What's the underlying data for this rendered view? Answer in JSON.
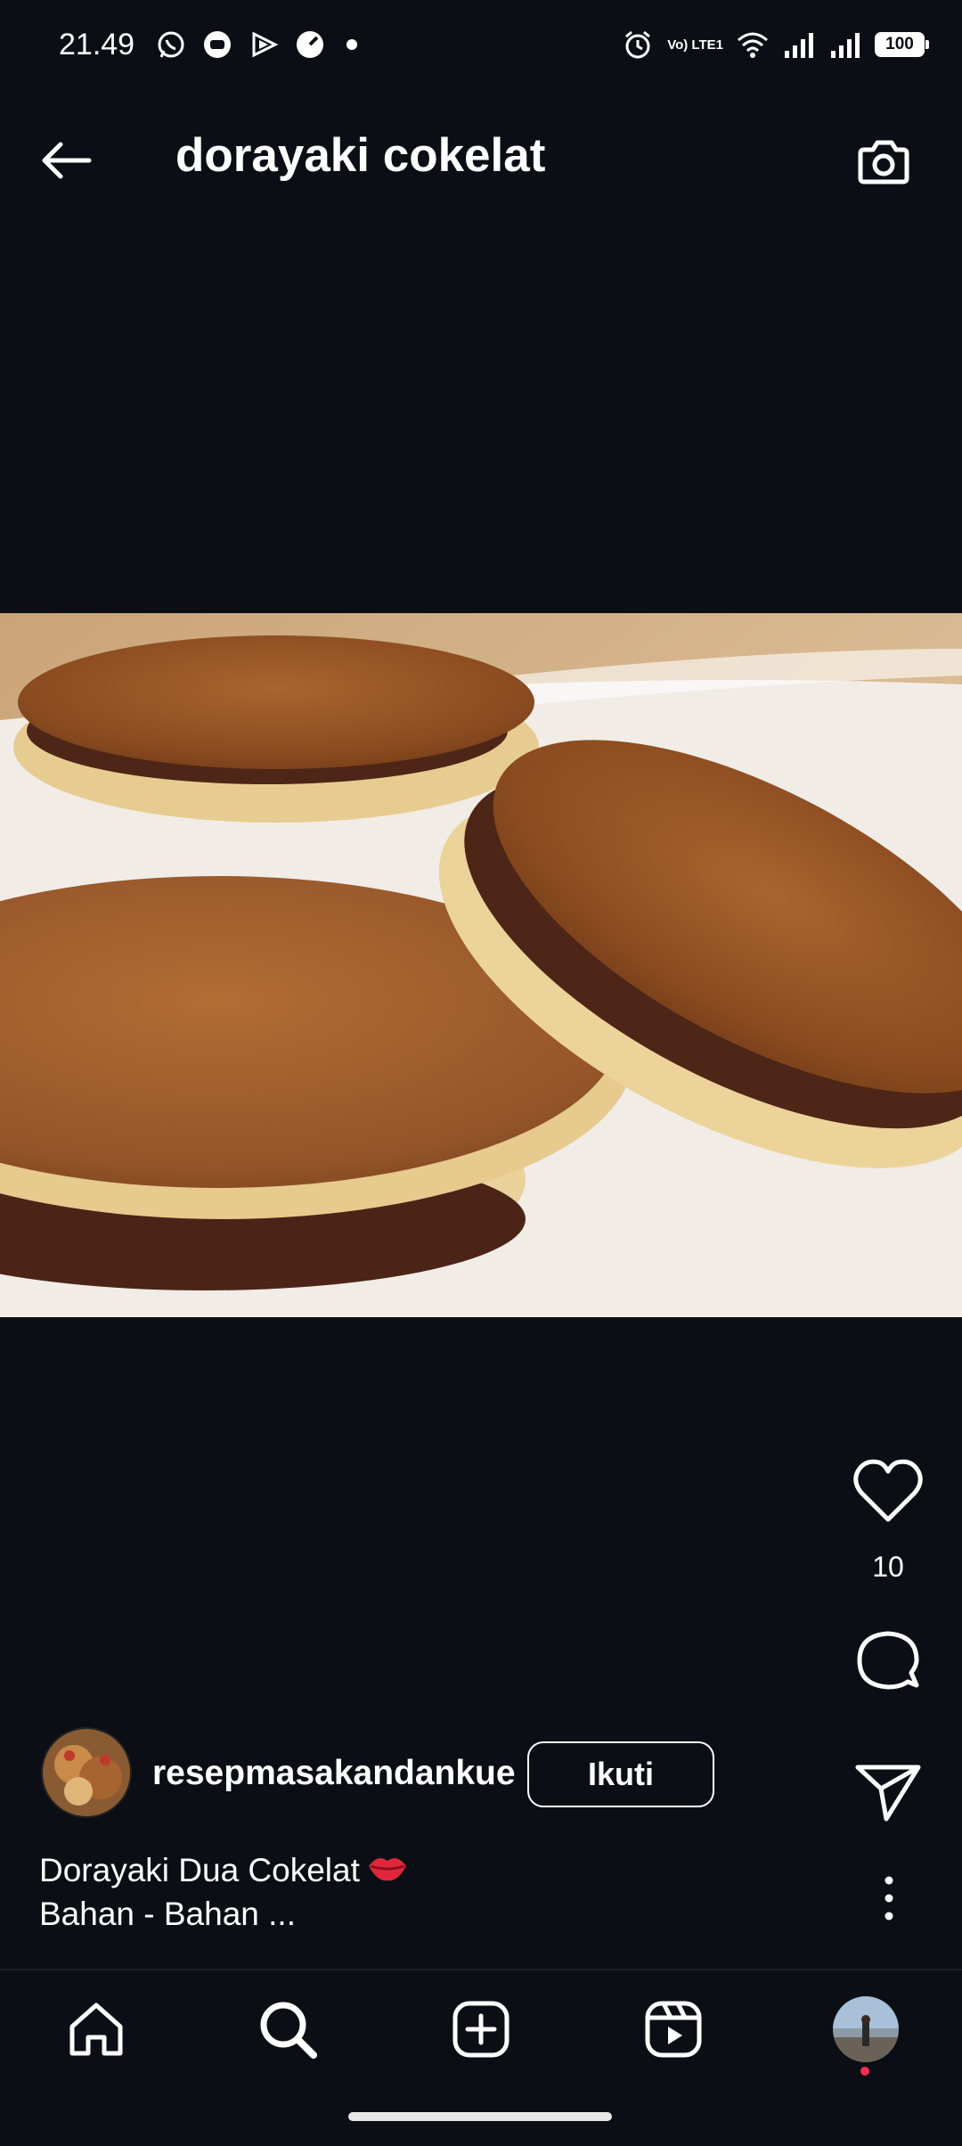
{
  "status_bar": {
    "time": "21.49",
    "battery": "100",
    "lte_label": "Vo) LTE1"
  },
  "header": {
    "title": "dorayaki cokelat"
  },
  "post": {
    "like_count": "10",
    "author": "resepmasakandankue",
    "follow_label": "Ikuti",
    "caption_line1": "Dorayaki Dua Cokelat",
    "caption_line2": "Bahan - Bahan ..."
  },
  "icons": {
    "back": "back-arrow-icon",
    "camera": "camera-icon",
    "like": "heart-icon",
    "comment": "comment-icon",
    "share": "send-icon",
    "more": "more-vertical-icon",
    "nav": [
      "home-icon",
      "search-icon",
      "create-icon",
      "reels-icon",
      "profile-avatar"
    ]
  },
  "colors": {
    "background": "#0b0f15",
    "text": "#ffffff",
    "notification_dot": "#ff2d55"
  }
}
